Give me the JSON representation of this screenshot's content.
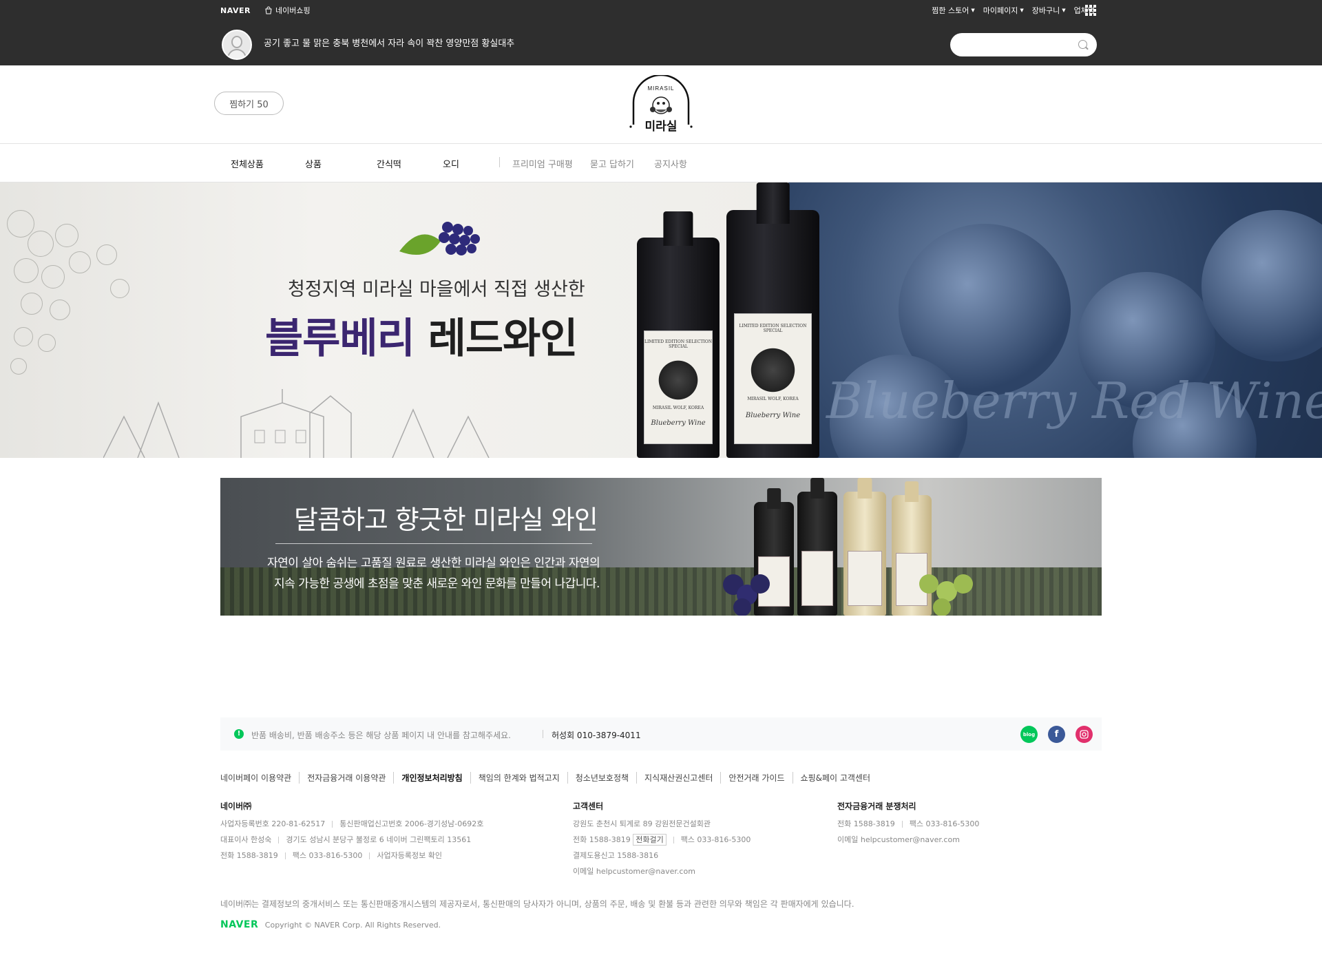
{
  "topbar": {
    "naver_logo": "NAVER",
    "shopping_label": "네이버쇼핑",
    "links": [
      "찜한 스토어",
      "마이페이지",
      "장바구니"
    ],
    "business_label": "업체명"
  },
  "store": {
    "description": "공기 좋고 물 맑은 충북 병천에서 자라 속이 꽉찬 영양만점 황실대추",
    "search_placeholder": ""
  },
  "header": {
    "favorite_label": "찜하기 50",
    "logo_arc_text": "MIRASIL",
    "logo_text": "미라실"
  },
  "nav": {
    "main_items": [
      "전체상품",
      "상품",
      "간식떡",
      "오디"
    ],
    "sub_items": [
      "프리미엄 구매평",
      "묻고 답하기",
      "공지사항"
    ]
  },
  "hero": {
    "subtitle": "청정지역 미라실 마을에서 직접 생산한",
    "title_purple": "블루베리",
    "title_dark": "레드와인",
    "script_text": "Blueberry Red Wine",
    "bottle_label_top": "LIMITED EDITION SELECTION SPECIAL",
    "bottle_label_brand": "MIRASIL WOLF, KOREA",
    "bottle_label_name": "Blueberry Wine"
  },
  "banner2": {
    "title": "달콤하고 향긋한 미라실 와인",
    "desc_line1": "자연이 살아 숨쉬는 고품질 원료로 생산한 미라실 와인은 인간과 자연의",
    "desc_line2": "지속 가능한 공생에 초점을 맞춘 새로운 와인 문화를 만들어 나갑니다."
  },
  "footer": {
    "notice_text": "반품 배송비, 반품 배송주소 등은 해당 상품 페이지 내 안내를 참고해주세요.",
    "notice_contact": "허성회 010-3879-4011",
    "social": [
      "blog",
      "f",
      "instagram"
    ],
    "links": [
      "네이버페이 이용약관",
      "전자금융거래 이용약관",
      "개인정보처리방침",
      "책임의 한계와 법적고지",
      "청소년보호정책",
      "지식재산권신고센터",
      "안전거래 가이드",
      "쇼핑&페이 고객센터"
    ],
    "col1": {
      "heading": "네이버㈜",
      "reg_no": "사업자등록번호 220-81-62517",
      "mail_order": "통신판매업신고번호 2006-경기성남-0692호",
      "ceo": "대표이사 한성숙",
      "address": "경기도 성남시 분당구 불정로 6 네이버 그린팩토리 13561",
      "tel": "전화 1588-3819",
      "fax": "팩스 033-816-5300",
      "biz_info": "사업자등록정보 확인"
    },
    "col2": {
      "heading": "고객센터",
      "address": "강원도 춘천시 퇴계로 89 강원전문건설회관",
      "tel": "전화 1588-3819",
      "call_button": "전화걸기",
      "fax": "팩스 033-816-5300",
      "payment": "결제도용신고 1588-3816",
      "email": "이메일 helpcustomer@naver.com"
    },
    "col3": {
      "heading": "전자금융거래 분쟁처리",
      "tel": "전화 1588-3819",
      "fax": "팩스 033-816-5300",
      "email": "이메일 helpcustomer@naver.com"
    },
    "disclaimer": "네이버㈜는 결제정보의 중개서비스 또는 통신판매중개시스템의 제공자로서, 통신판매의 당사자가 아니며, 상품의 주문, 배송 및 환불 등과 관련한 의무와 책임은 각 판매자에게 있습니다.",
    "copyright_logo": "NAVER",
    "copyright": "Copyright © NAVER Corp. All Rights Reserved."
  },
  "colors": {
    "dark_bar": "#2e2e2e",
    "naver_green": "#03c75a",
    "hero_purple": "#3b2670",
    "blog": "#03c75a",
    "facebook": "#3b5998",
    "instagram": "#e1306c"
  }
}
